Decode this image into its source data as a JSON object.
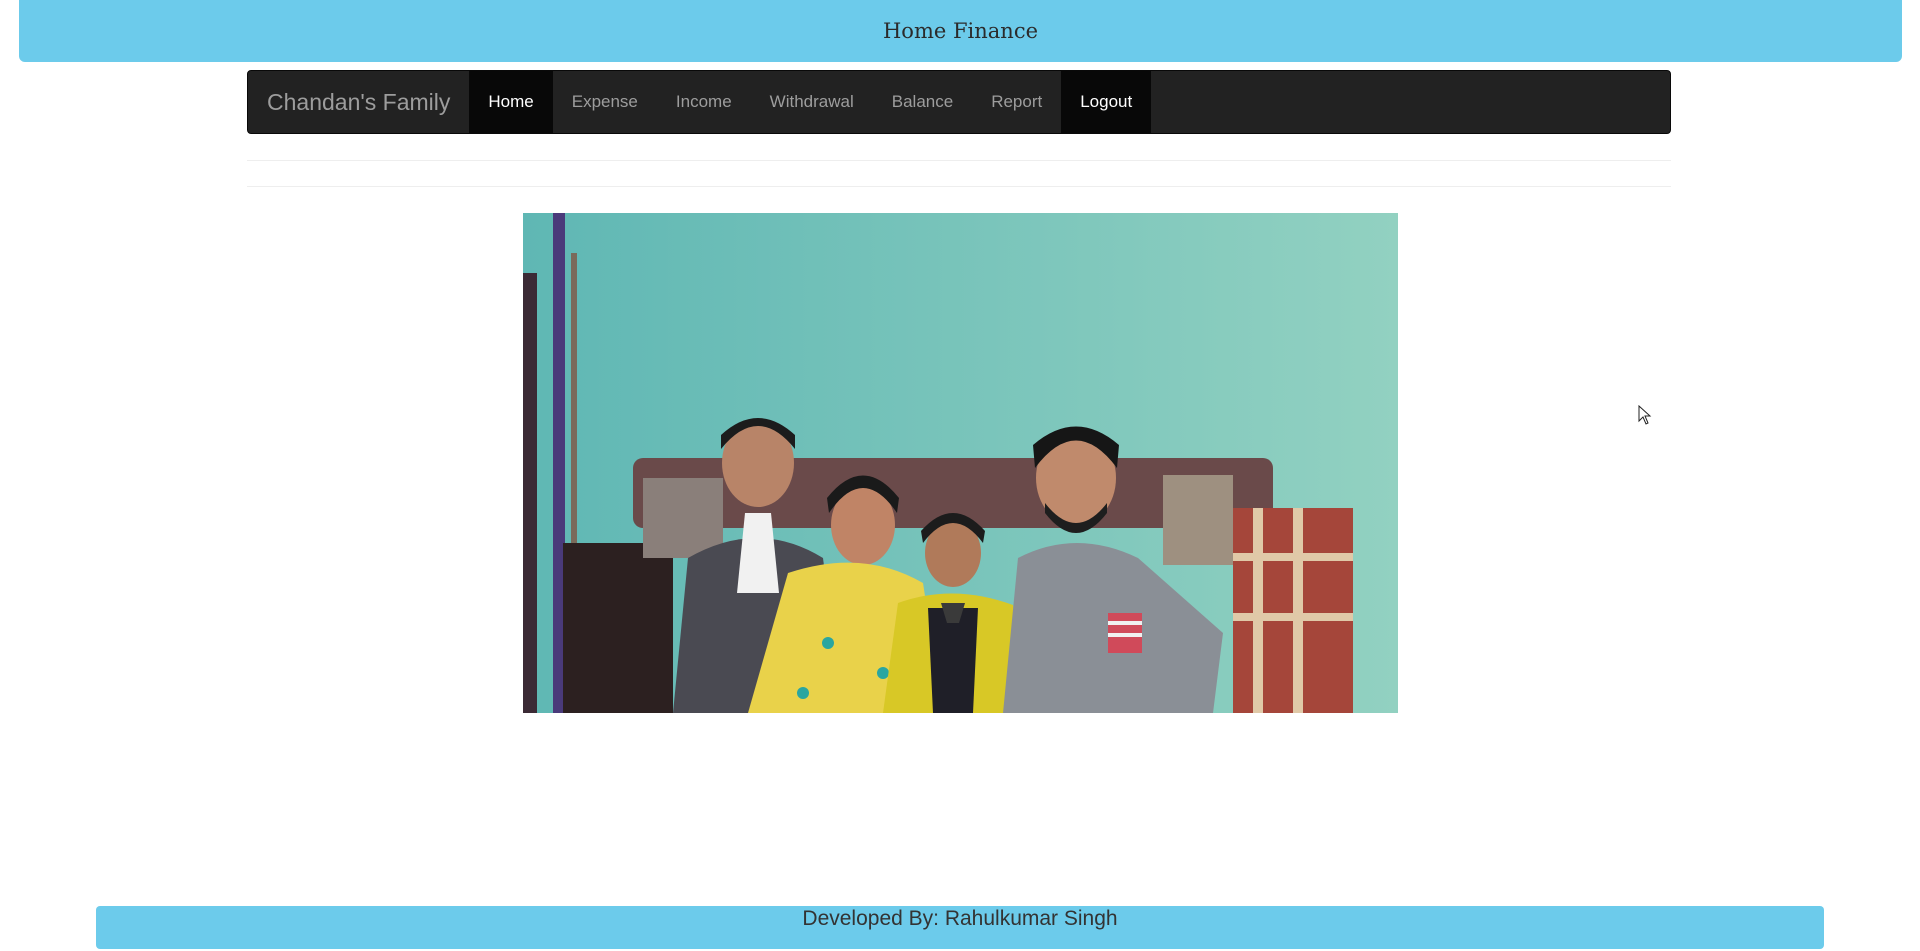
{
  "banner": {
    "title": "Home Finance"
  },
  "navbar": {
    "brand": "Chandan's Family",
    "items": [
      {
        "label": "Home",
        "active": true
      },
      {
        "label": "Expense",
        "active": false
      },
      {
        "label": "Income",
        "active": false
      },
      {
        "label": "Withdrawal",
        "active": false
      },
      {
        "label": "Balance",
        "active": false
      },
      {
        "label": "Report",
        "active": false
      },
      {
        "label": "Logout",
        "active": false
      }
    ]
  },
  "main": {
    "photo_icon": "family-photo"
  },
  "footer": {
    "credit": "Developed By: Rahulkumar Singh"
  },
  "colors": {
    "banner": "#6ccbeb",
    "navbar": "#222222",
    "nav_active": "#080808",
    "nav_text": "#9d9d9d",
    "wall": "#6fc1b6"
  }
}
